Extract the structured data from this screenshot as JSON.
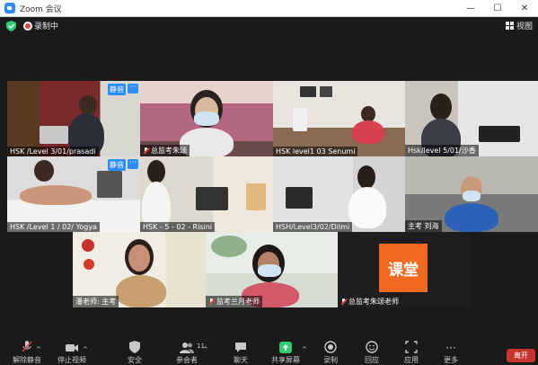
{
  "window": {
    "title": "Zoom 会议"
  },
  "topbar": {
    "recording_label": "录制中",
    "view_label": "视图"
  },
  "tiles": [
    {
      "name": "HSK /Level 3/01/prasadi",
      "muted_badge": "静音"
    },
    {
      "name": "总监考朱颂"
    },
    {
      "name": "HSK level1 03 Senumi"
    },
    {
      "name": "Hsk/level 5/01/沙香"
    },
    {
      "name": "HSK /Level 1 / 02/ Yogya",
      "muted_badge": "静音"
    },
    {
      "name": "HSK - 5 - 02 - Risini"
    },
    {
      "name": "HSH/Level3/02/Dilmi"
    },
    {
      "name": "主考 刘海"
    },
    {
      "name": "潘老师: 主考"
    },
    {
      "name": "监考兰月老师"
    },
    {
      "name": "总监考朱颂老师",
      "logo_text": "课堂"
    }
  ],
  "toolbar": {
    "unmute": "解除静音",
    "stop_video": "停止视频",
    "security": "安全",
    "participants": "参会者",
    "participants_count": "11",
    "chat": "聊天",
    "share": "共享屏幕",
    "record": "录制",
    "reactions": "回应",
    "apps": "应用",
    "more": "更多",
    "leave": "离开"
  },
  "colors": {
    "accent": "#2d8cff",
    "active_border": "#d8e04a",
    "leave": "#c8332b",
    "share": "#2ecc71"
  }
}
